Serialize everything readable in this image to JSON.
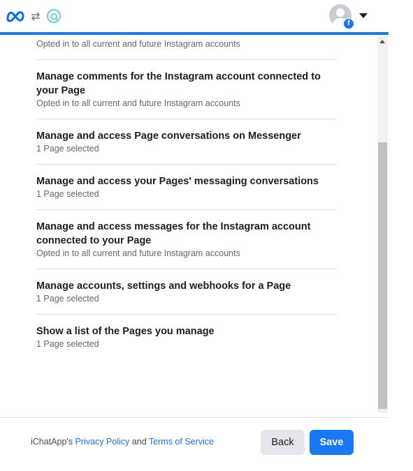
{
  "header": {
    "logos": [
      "meta-logo",
      "sync-arrows-icon",
      "ichatapp-logo"
    ],
    "accent": "#1877f2"
  },
  "permissions": [
    {
      "title": "",
      "subtitle": "Opted in to all current and future Instagram accounts"
    },
    {
      "title": "Manage comments for the Instagram account connected to your Page",
      "subtitle": "Opted in to all current and future Instagram accounts"
    },
    {
      "title": "Manage and access Page conversations on Messenger",
      "subtitle": "1 Page selected"
    },
    {
      "title": "Manage and access your Pages' messaging conversations",
      "subtitle": "1 Page selected"
    },
    {
      "title": "Manage and access messages for the Instagram account connected to your Page",
      "subtitle": "Opted in to all current and future Instagram accounts"
    },
    {
      "title": "Manage accounts, settings and webhooks for a Page",
      "subtitle": "1 Page selected"
    },
    {
      "title": "Show a list of the Pages you manage",
      "subtitle": "1 Page selected"
    }
  ],
  "footer": {
    "legal_prefix": "iChatApp's ",
    "privacy_label": "Privacy Policy",
    "and_text": " and ",
    "terms_label": "Terms of Service",
    "back_label": "Back",
    "save_label": "Save"
  }
}
